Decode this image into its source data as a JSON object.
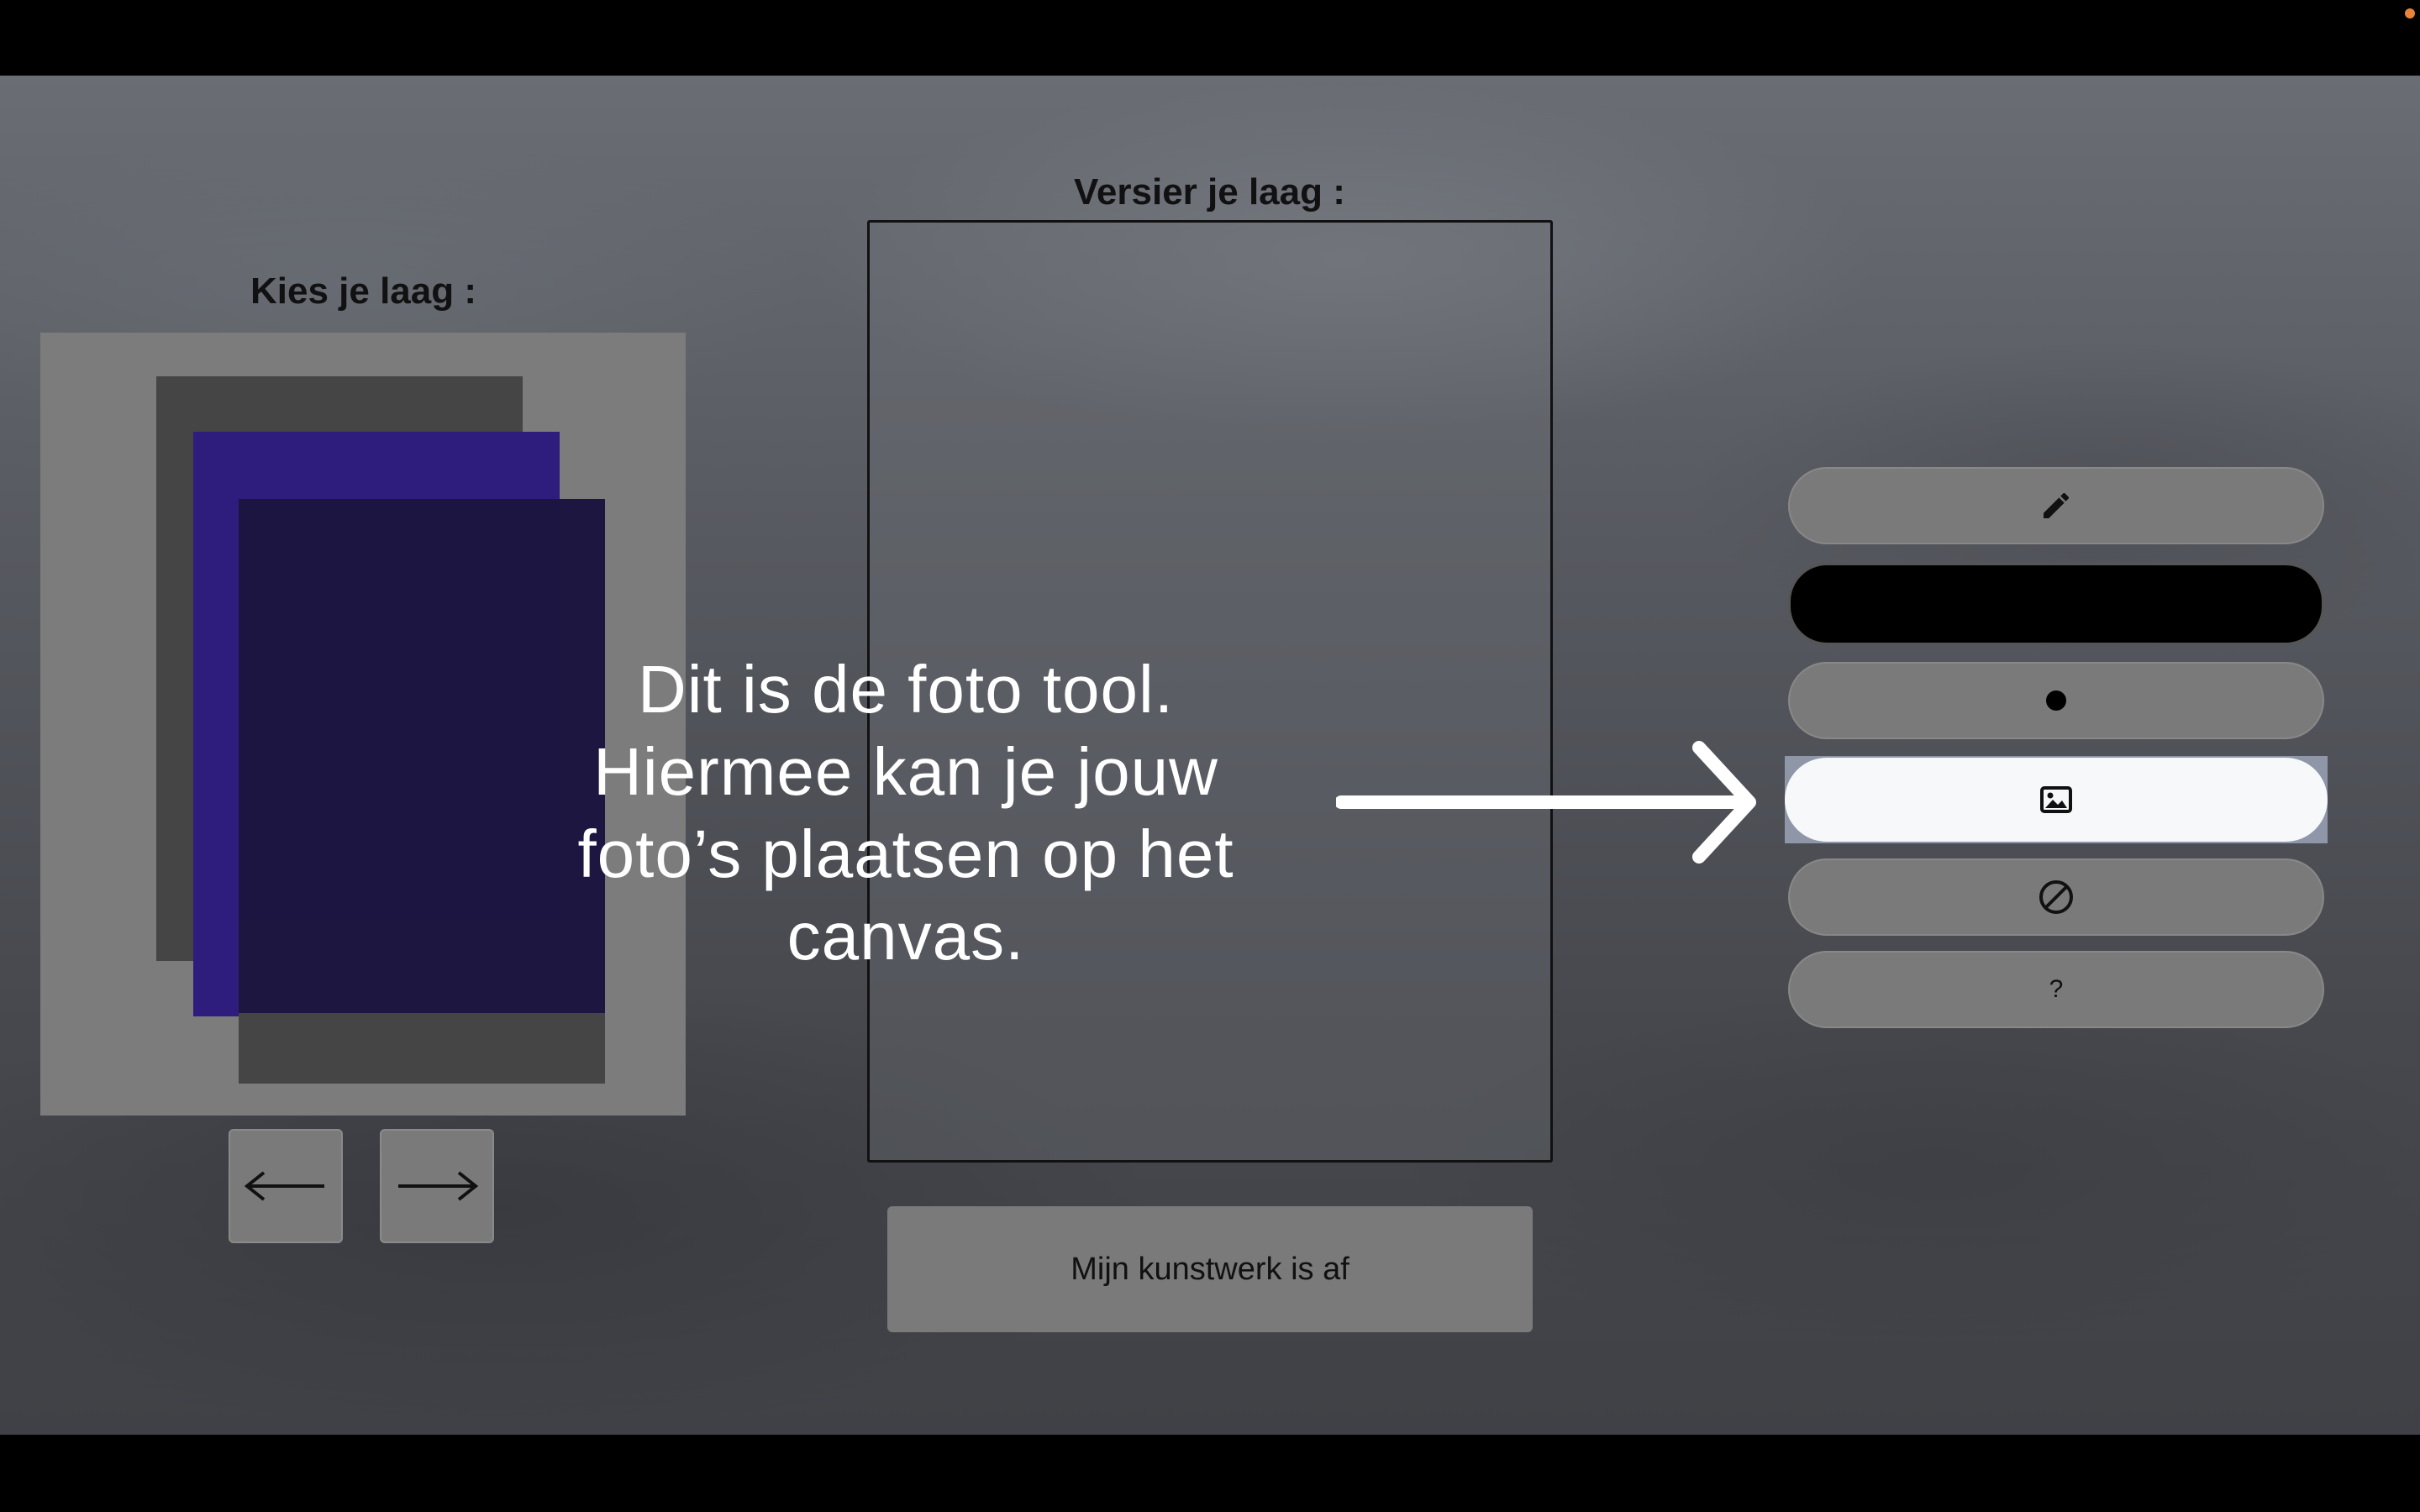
{
  "headings": {
    "choose_layer": "Kies je laag :",
    "decorate_layer": "Versier je laag :"
  },
  "layer_nav": {
    "previous_icon": "arrow-left-icon",
    "next_icon": "arrow-right-icon"
  },
  "done_button": {
    "label": "Mijn kunstwerk is af"
  },
  "tools": [
    {
      "name": "pencil",
      "icon": "pencil-icon",
      "label": ""
    },
    {
      "name": "color",
      "icon": "",
      "label": "",
      "color": "#000000"
    },
    {
      "name": "brush-size",
      "icon": "dot-icon",
      "label": ""
    },
    {
      "name": "photo",
      "icon": "image-icon",
      "label": "",
      "highlighted": true
    },
    {
      "name": "eraser",
      "icon": "no-entry-icon",
      "label": ""
    },
    {
      "name": "help",
      "icon": "question-icon",
      "label": "?"
    }
  ],
  "tutorial": {
    "lines": [
      "Dit is de foto tool.",
      "Hiermee kan je jouw",
      "foto’s plaatsen op het",
      "canvas."
    ]
  },
  "colors": {
    "layer_back": "#454545",
    "layer_mid": "#2e1d7c",
    "layer_front": "#1c1540",
    "tool_highlight": "#f7f8fa",
    "status_dot": "#e8833a"
  }
}
